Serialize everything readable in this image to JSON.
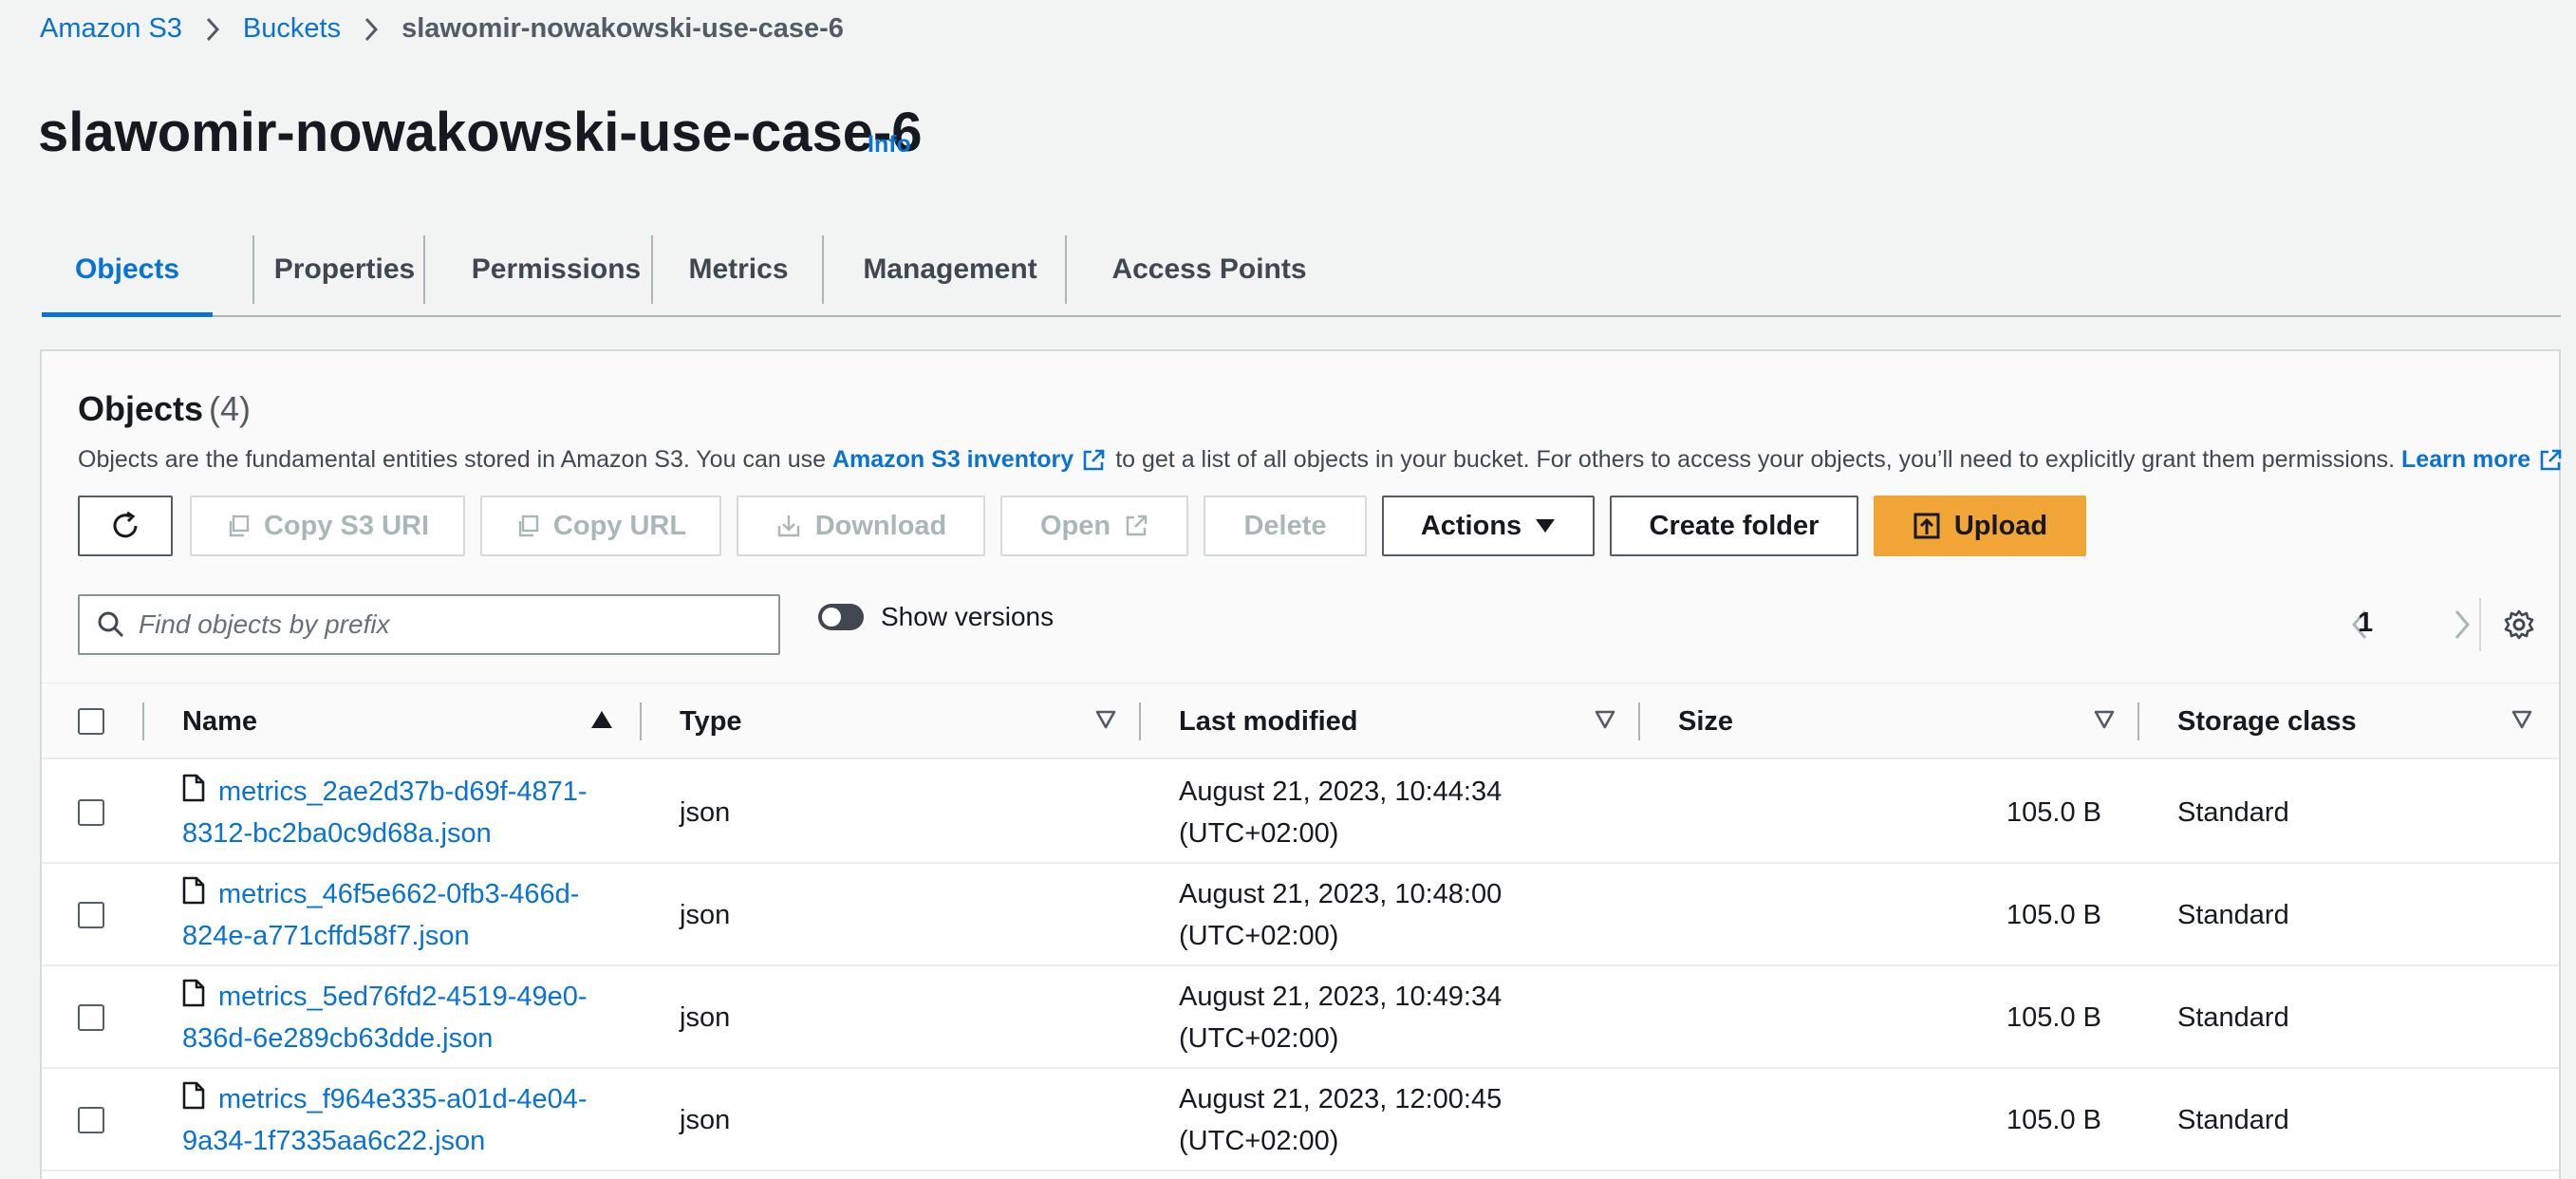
{
  "breadcrumb": {
    "items": [
      "Amazon S3",
      "Buckets"
    ],
    "current": "slawomir-nowakowski-use-case-6"
  },
  "page": {
    "title": "slawomir-nowakowski-use-case-6",
    "info_label": "Info"
  },
  "tabs": [
    "Objects",
    "Properties",
    "Permissions",
    "Metrics",
    "Management",
    "Access Points"
  ],
  "objects_panel": {
    "heading": "Objects",
    "count": "(4)",
    "description": {
      "before": "Objects are the fundamental entities stored in Amazon S3. You can use",
      "inventory_link": "Amazon S3 inventory",
      "middle": "to get a list of all objects in your bucket. For others to access your objects, you’ll need to explicitly grant them permissions.",
      "learn_more": "Learn more"
    },
    "buttons": {
      "copy_s3_uri": "Copy S3 URI",
      "copy_url": "Copy URL",
      "download": "Download",
      "open": "Open",
      "delete": "Delete",
      "actions": "Actions",
      "create_folder": "Create folder",
      "upload": "Upload"
    },
    "search": {
      "placeholder": "Find objects by prefix"
    },
    "show_versions_label": "Show versions",
    "page_number": "1"
  },
  "table": {
    "columns": [
      "Name",
      "Type",
      "Last modified",
      "Size",
      "Storage class"
    ],
    "rows": [
      {
        "name_line1": "metrics_2ae2d37b-d69f-4871-",
        "name_line2": "8312-bc2ba0c9d68a.json",
        "type": "json",
        "date_line1": "August 21, 2023, 10:44:34",
        "date_line2": "(UTC+02:00)",
        "size": "105.0 B",
        "storage_class": "Standard"
      },
      {
        "name_line1": "metrics_46f5e662-0fb3-466d-",
        "name_line2": "824e-a771cffd58f7.json",
        "type": "json",
        "date_line1": "August 21, 2023, 10:48:00",
        "date_line2": "(UTC+02:00)",
        "size": "105.0 B",
        "storage_class": "Standard"
      },
      {
        "name_line1": "metrics_5ed76fd2-4519-49e0-",
        "name_line2": "836d-6e289cb63dde.json",
        "type": "json",
        "date_line1": "August 21, 2023, 10:49:34",
        "date_line2": "(UTC+02:00)",
        "size": "105.0 B",
        "storage_class": "Standard"
      },
      {
        "name_line1": "metrics_f964e335-a01d-4e04-",
        "name_line2": "9a34-1f7335aa6c22.json",
        "type": "json",
        "date_line1": "August 21, 2023, 12:00:45",
        "date_line2": "(UTC+02:00)",
        "size": "105.0 B",
        "storage_class": "Standard"
      }
    ]
  }
}
